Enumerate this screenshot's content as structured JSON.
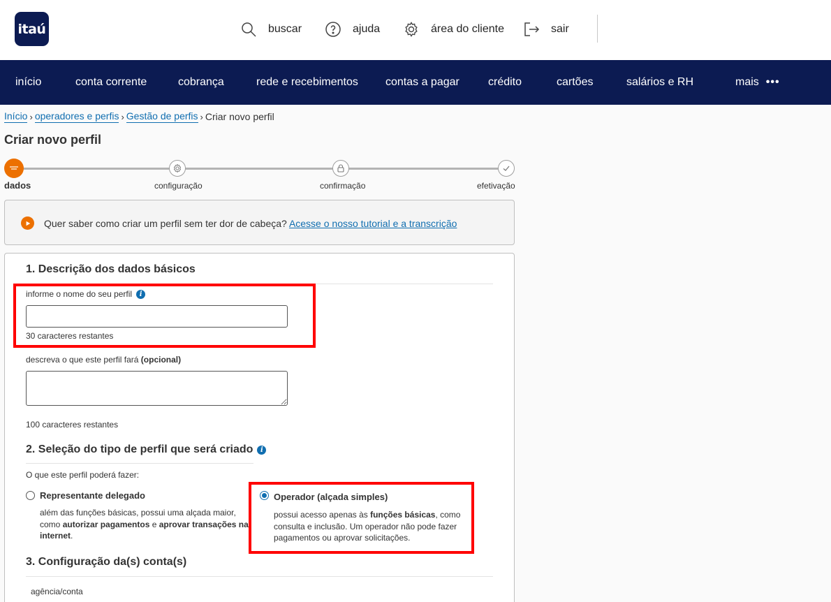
{
  "header": {
    "logo": "itaú",
    "util": [
      {
        "icon": "search-icon",
        "label": "buscar"
      },
      {
        "icon": "help-icon",
        "label": "ajuda"
      },
      {
        "icon": "gear-icon",
        "label": "área do cliente"
      },
      {
        "icon": "logout-icon",
        "label": "sair"
      }
    ]
  },
  "nav": {
    "items": [
      "início",
      "conta corrente",
      "cobrança",
      "rede e recebimentos",
      "contas a pagar",
      "crédito",
      "cartões",
      "salários e RH"
    ],
    "more": "mais",
    "more_icon": "•••"
  },
  "breadcrumb": {
    "items": [
      "Início",
      "operadores e perfis",
      "Gestão de perfis"
    ],
    "current": "Criar novo perfil"
  },
  "page": {
    "title": "Criar novo perfil"
  },
  "stepper": {
    "steps": [
      "dados",
      "configuração",
      "confirmação",
      "efetivação"
    ],
    "active_index": 0
  },
  "tutorial": {
    "text": "Quer saber como criar um perfil sem ter dor de cabeça?",
    "link": "Acesse o nosso tutorial e a transcrição"
  },
  "section1": {
    "title": "1. Descrição dos dados básicos",
    "name_label": "informe o nome do seu perfil",
    "name_value": "",
    "name_remaining": "30 caracteres restantes",
    "desc_label": "descreva o que este perfil fará",
    "desc_optional": "(opcional)",
    "desc_value": "",
    "desc_remaining": "100 caracteres restantes"
  },
  "section2": {
    "title": "2. Seleção do tipo de perfil que será criado",
    "prompt": "O que este perfil poderá fazer:",
    "options": [
      {
        "title": "Representante delegado",
        "checked": false,
        "desc_1": "além das funções básicas, possui uma alçada maior, como ",
        "desc_b1": "autorizar pagamentos",
        "desc_2": " e ",
        "desc_b2": "aprovar transações na internet",
        "desc_3": "."
      },
      {
        "title": "Operador (alçada simples)",
        "checked": true,
        "desc_1": "possui acesso apenas às ",
        "desc_b1": "funções básicas",
        "desc_2": ", como consulta e inclusão. Um operador não pode fazer pagamentos ou aprovar solicitações."
      }
    ]
  },
  "section3": {
    "title": "3. Configuração da(s) conta(s)",
    "account_label": "agência/conta"
  },
  "colors": {
    "brand_navy": "#0c1b52",
    "accent_orange": "#ec7000",
    "link_blue": "#106eb0",
    "highlight_red": "#ff0000"
  }
}
